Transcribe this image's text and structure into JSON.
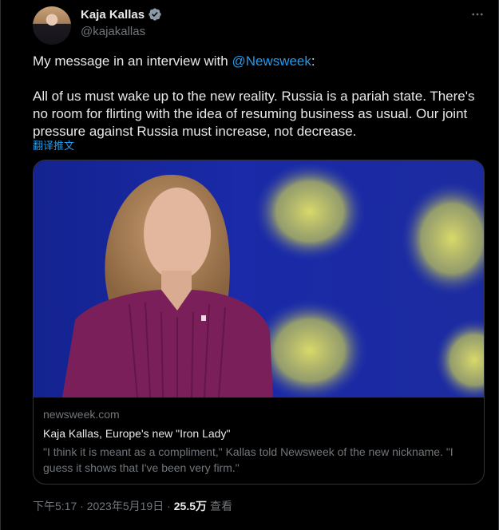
{
  "author": {
    "name": "Kaja Kallas",
    "handle": "@kajakallas"
  },
  "tweet": {
    "intro_before": "My message in an interview with ",
    "mention": "@Newsweek",
    "intro_after": ":",
    "body": "All of us must wake up to the new reality. Russia is a pariah state. There's no room for flirting with the idea of resuming business as usual. Our joint pressure against Russia must increase, not decrease.",
    "translate_label": "翻译推文"
  },
  "card": {
    "domain": "newsweek.com",
    "title": "Kaja Kallas, Europe's new \"Iron Lady\"",
    "description": "\"I think it is meant as a compliment,\" Kallas told Newsweek of the new nickname. \"I guess it shows that I've been very firm.\""
  },
  "footer": {
    "time": "下午5:17 · 2023年5月19日 · ",
    "views_count": "25.5万",
    "views_label": " 查看"
  },
  "icons": {
    "verified": "verified-badge-icon",
    "more": "more-options-icon"
  },
  "colors": {
    "background": "#000000",
    "text": "#e7e9ea",
    "secondary": "#71767b",
    "link": "#1d9bf0",
    "border": "#2f3336"
  }
}
